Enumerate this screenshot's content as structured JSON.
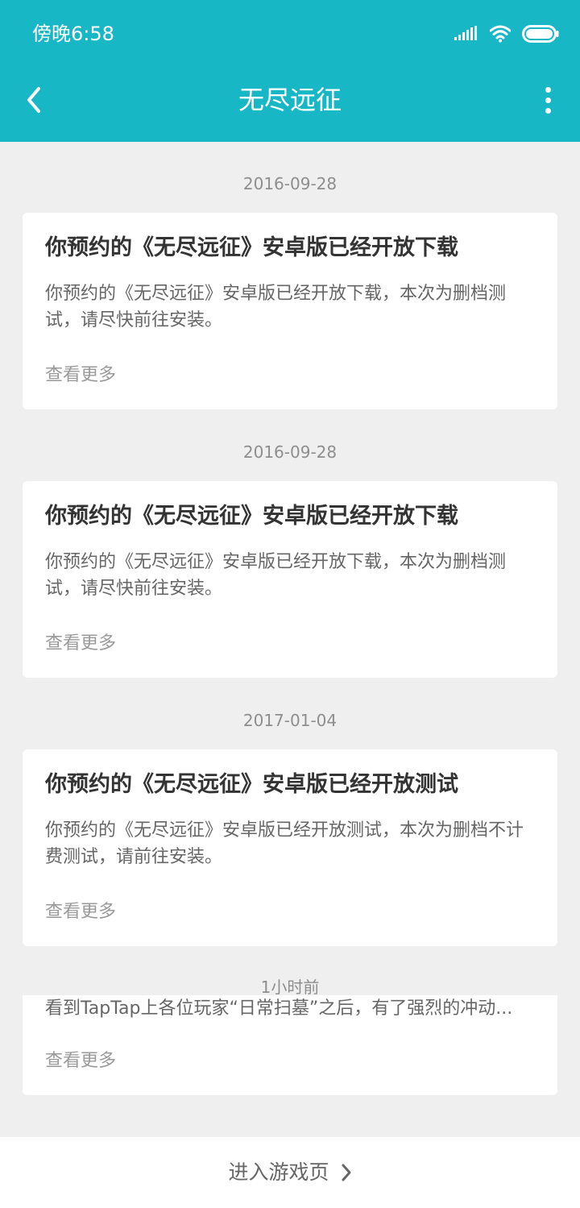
{
  "status_bar": {
    "time": "傍晚6:58",
    "icons": [
      "signal-icon",
      "wifi-icon",
      "battery-icon"
    ]
  },
  "nav": {
    "title": "无尽远征",
    "back_icon": "chevron-left-icon",
    "menu_icon": "more-vertical-icon"
  },
  "feed": [
    {
      "date": "2016-09-28",
      "title": "你预约的《无尽远征》安卓版已经开放下载",
      "body": "你预约的《无尽远征》安卓版已经开放下载，本次为删档测试，请尽快前往安装。",
      "more": "查看更多"
    },
    {
      "date": "2016-09-28",
      "title": "你预约的《无尽远征》安卓版已经开放下载",
      "body": "你预约的《无尽远征》安卓版已经开放下载，本次为删档测试，请尽快前往安装。",
      "more": "查看更多"
    },
    {
      "date": "2017-01-04",
      "title": "你预约的《无尽远征》安卓版已经开放测试",
      "body": "你预约的《无尽远征》安卓版已经开放测试，本次为删档不计费测试，请前往安装。",
      "more": "查看更多"
    },
    {
      "date": "1小时前",
      "body": "看到TapTap上各位玩家“日常扫墓”之后，有了强烈的冲动...",
      "more": "查看更多"
    }
  ],
  "bottom": {
    "label": "进入游戏页",
    "icon": "chevron-right-icon"
  },
  "colors": {
    "accent": "#17b7c6",
    "background": "#efefef",
    "card": "#ffffff"
  }
}
